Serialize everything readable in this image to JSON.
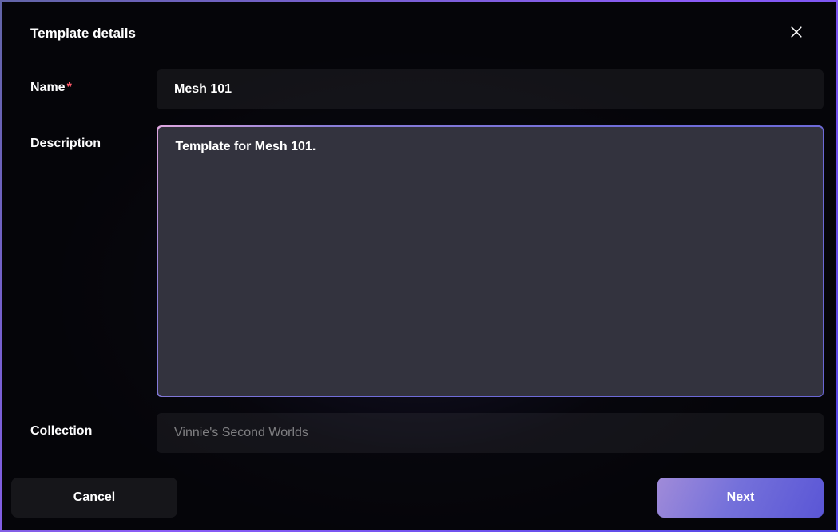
{
  "header": {
    "title": "Template details"
  },
  "form": {
    "name": {
      "label": "Name",
      "required": "*",
      "value": "Mesh 101"
    },
    "description": {
      "label": "Description",
      "value": "Template for Mesh 101."
    },
    "collection": {
      "label": "Collection",
      "placeholder": "Vinnie's Second Worlds"
    }
  },
  "footer": {
    "cancel_label": "Cancel",
    "next_label": "Next"
  }
}
